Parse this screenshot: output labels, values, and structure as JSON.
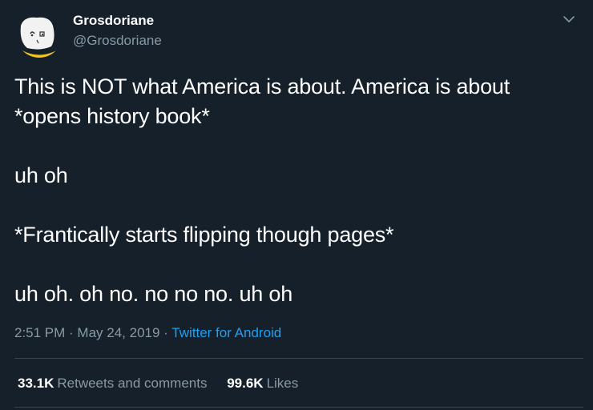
{
  "author": {
    "display_name": "Grosdoriane",
    "handle": "@Grosdoriane",
    "avatar_icon": "cartoon-face-avatar-icon"
  },
  "menu_icon": "chevron-down-icon",
  "tweet": {
    "lines": [
      "This is NOT what America is about. America is about\n*opens history book*",
      "uh oh",
      "*Frantically starts flipping though pages*",
      "uh oh. oh no. no no no. uh oh"
    ]
  },
  "meta": {
    "time": "2:51 PM",
    "separator1": " · ",
    "date": "May 24, 2019",
    "separator2": " · ",
    "source": "Twitter for Android"
  },
  "stats": {
    "retweets_count": "33.1K",
    "retweets_label": "Retweets and comments",
    "likes_count": "99.6K",
    "likes_label": "Likes"
  },
  "colors": {
    "background": "#15202b",
    "text": "#ffffff",
    "secondary_text": "#8899a6",
    "link": "#1da1f2",
    "divider": "#38444d"
  }
}
